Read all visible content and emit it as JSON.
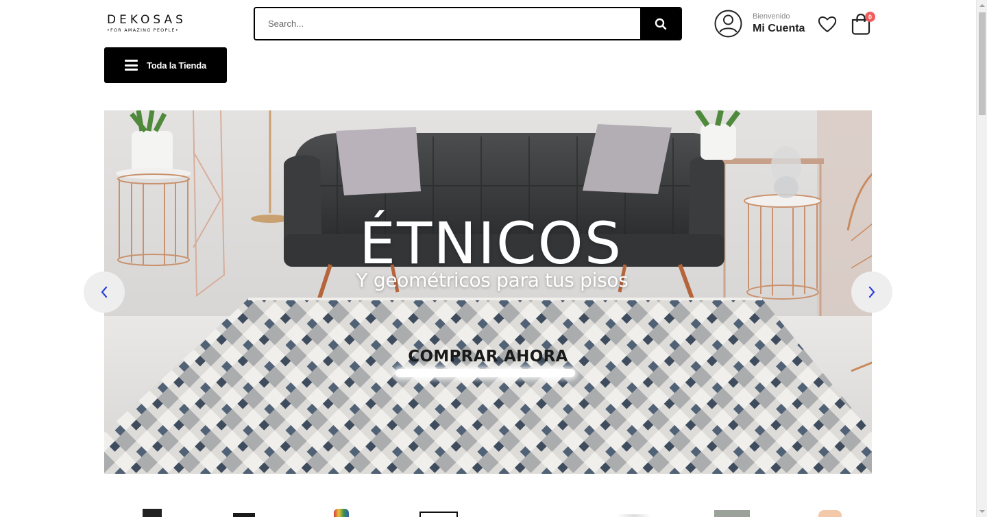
{
  "brand": {
    "name": "DEKOSAS",
    "tagline": "•FOR AMAZING PEOPLE•"
  },
  "search": {
    "placeholder": "Search...",
    "icon": "search-icon"
  },
  "account": {
    "greeting": "Bienvenido",
    "label": "Mi Cuenta",
    "icon": "user-icon"
  },
  "wishlist": {
    "icon": "heart-icon"
  },
  "cart": {
    "icon": "shopping-bag-icon",
    "count": "0"
  },
  "nav": {
    "store_label": "Toda la Tienda",
    "icon": "menu-icon"
  },
  "hero": {
    "title": "ÉTNICOS",
    "subtitle": "Y geométricos para tus pisos",
    "cta": "COMPRAR AHORA",
    "prev_icon": "chevron-left-icon",
    "next_icon": "chevron-right-icon"
  },
  "colors": {
    "primary": "#000000",
    "badge": "#f25c5c",
    "arrow": "#2b3fd6"
  }
}
